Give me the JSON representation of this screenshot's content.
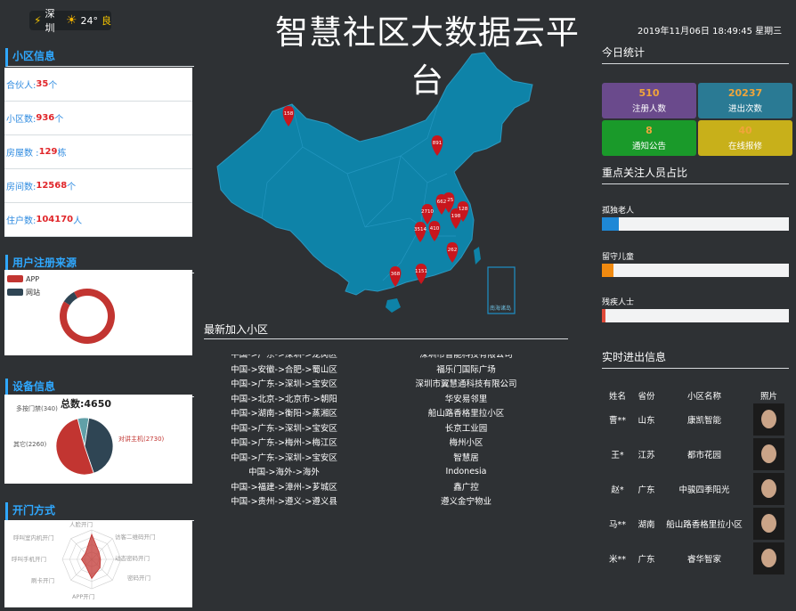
{
  "header": {
    "city": "深圳",
    "temperature": "24°",
    "air_quality": "良",
    "title": "智慧社区大数据云平台",
    "datetime": "2019年11月06日 18:49:45 星期三"
  },
  "community_info": {
    "title": "小区信息",
    "rows": [
      {
        "label": "合伙人:",
        "value": "35",
        "unit": "个"
      },
      {
        "label": "小区数:",
        "value": "936",
        "unit": "个"
      },
      {
        "label": "房屋数 :",
        "value": "129",
        "unit": "栋"
      },
      {
        "label": "房间数:",
        "value": "12568",
        "unit": " 个"
      },
      {
        "label": "住户数:",
        "value": "104170",
        "unit": " 人"
      }
    ]
  },
  "registration": {
    "title": "用户注册来源",
    "legend": [
      "APP",
      "网站"
    ],
    "colors": [
      "#c23531",
      "#2f4554"
    ],
    "values": [
      92,
      8
    ]
  },
  "devices": {
    "title": "设备信息",
    "total_label": "总数:4650",
    "labels": [
      "多按门禁(340)",
      "其它(2260)",
      "对讲主机(2730)"
    ],
    "values": [
      340,
      2260,
      2730
    ],
    "colors": [
      "#61a0a8",
      "#2f4554",
      "#c23531"
    ]
  },
  "open_methods": {
    "title": "开门方式",
    "axes": [
      "人脸开门",
      "访客二维码开门",
      "动态密码开门",
      "密码开门",
      "APP开门",
      "刷卡开门",
      "呼叫手机开门",
      "呼叫室内机开门"
    ],
    "values": [
      0.85,
      0.35,
      0.3,
      0.4,
      0.65,
      0.3,
      0.35,
      0.3
    ]
  },
  "map": {
    "region_label": "南海诸岛",
    "markers": [
      "158",
      "891",
      "725",
      "662",
      "128",
      "2710",
      "198",
      "3514",
      "410",
      "262",
      "1151",
      "368"
    ]
  },
  "new_communities": {
    "title": "最新加入小区",
    "rows": [
      {
        "path": "中国->广东->深圳->龙岗区",
        "name": "深圳市智能科技有限公司"
      },
      {
        "path": "中国->安徽->合肥->蜀山区",
        "name": "福乐门国际广场"
      },
      {
        "path": "中国->广东->深圳->宝安区",
        "name": "深圳市翼慧通科技有限公司"
      },
      {
        "path": "中国->北京->北京市->朝阳",
        "name": "华安易邻里"
      },
      {
        "path": "中国->湖南->衡阳->蒸湘区",
        "name": "船山路香格里拉小区"
      },
      {
        "path": "中国->广东->深圳->宝安区",
        "name": "长京工业园"
      },
      {
        "path": "中国->广东->梅州->梅江区",
        "name": "梅州小区"
      },
      {
        "path": "中国->广东->深圳->宝安区",
        "name": "智慧居"
      },
      {
        "path": "中国->海外->海外",
        "name": "Indonesia"
      },
      {
        "path": "中国->福建->漳州->芗城区",
        "name": "鑫广控"
      },
      {
        "path": "中国->贵州->遵义->遵义县",
        "name": "遵义金宁物业"
      }
    ]
  },
  "today_stats": {
    "title": "今日统计",
    "cards": [
      {
        "value": "510",
        "label": "注册人数",
        "bg": "#6a4a8c",
        "color": "#f0a53a"
      },
      {
        "value": "20237",
        "label": "进出次数",
        "bg": "#2a7a94",
        "color": "#f0a53a"
      },
      {
        "value": "8",
        "label": "通知公告",
        "bg": "#1a9a2a",
        "color": "#f0a53a"
      },
      {
        "value": "40",
        "label": "在线报修",
        "bg": "#c8b01a",
        "color": "#f0a53a"
      }
    ]
  },
  "focus_people": {
    "title": "重点关注人员占比",
    "items": [
      {
        "label": "孤独老人",
        "value": 0.09,
        "color": "#1e88d6"
      },
      {
        "label": "留守儿童",
        "value": 0.06,
        "color": "#f08a10"
      },
      {
        "label": "残疾人士",
        "value": 0.02,
        "color": "#e04a3a"
      }
    ]
  },
  "realtime": {
    "title": "实时进出信息",
    "headers": [
      "姓名",
      "省份",
      "小区名称",
      "照片"
    ],
    "rows": [
      {
        "name": "曹**",
        "prov": "山东",
        "comm": "康凯智能"
      },
      {
        "name": "王*",
        "prov": "江苏",
        "comm": "都市花园"
      },
      {
        "name": "赵*",
        "prov": "广东",
        "comm": "中骏四季阳光"
      },
      {
        "name": "马**",
        "prov": "湖南",
        "comm": "船山路香格里拉小区"
      },
      {
        "name": "米**",
        "prov": "广东",
        "comm": "睿华智家"
      }
    ]
  }
}
